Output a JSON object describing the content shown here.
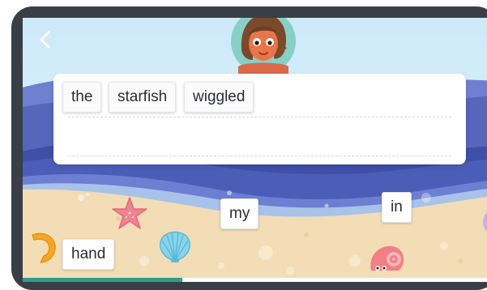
{
  "sentence": {
    "words": [
      "the",
      "starfish",
      "wiggled"
    ]
  },
  "word_bank": {
    "words": [
      "my",
      "in",
      "hand"
    ]
  },
  "progress": {
    "fraction": 0.34
  },
  "icons": {
    "back": "chevron-left-icon",
    "avatar": "girl-avatar",
    "starfish": "starfish-icon",
    "shell": "scallop-shell-icon",
    "conch": "conch-shell-icon",
    "crab": "hermit-crab-icon"
  },
  "colors": {
    "sea_dark": "#3b4aa0",
    "sea_mid": "#5a6cc4",
    "sand": "#f3ddb6",
    "progress": "#2c9f8a"
  }
}
